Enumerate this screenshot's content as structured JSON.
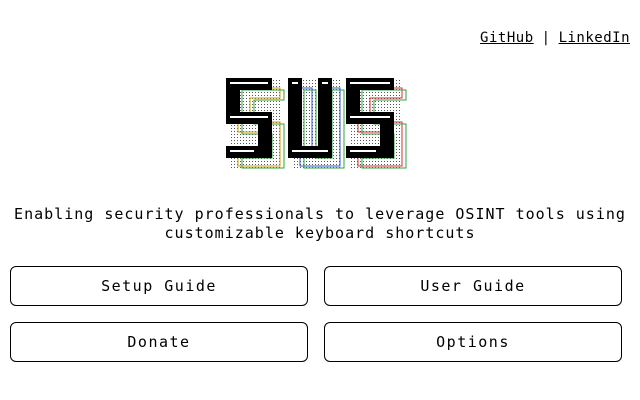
{
  "header": {
    "github_label": "GitHub",
    "separator": "|",
    "linkedin_label": "LinkedIn"
  },
  "logo": {
    "icon": "sus-ascii-logo",
    "text": "SUS"
  },
  "tagline": {
    "line1": "Enabling security professionals to leverage OSINT tools using",
    "line2": "customizable keyboard shortcuts"
  },
  "buttons": {
    "setup_guide": "Setup Guide",
    "user_guide": "User Guide",
    "donate": "Donate",
    "options": "Options"
  }
}
